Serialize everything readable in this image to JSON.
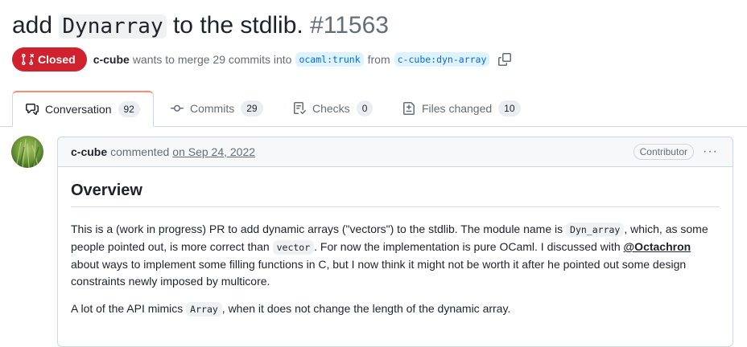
{
  "pr": {
    "title_before": "add ",
    "title_code": "Dynarray",
    "title_after": " to the stdlib. ",
    "number": "#11563",
    "state": "Closed",
    "author": "c-cube",
    "merge_text": "wants to merge 29 commits into",
    "base_branch": "ocaml:trunk",
    "from_text": "from",
    "head_branch": "c-cube:dyn-array"
  },
  "tabs": [
    {
      "label": "Conversation",
      "count": "92",
      "icon": "comment-discussion-icon"
    },
    {
      "label": "Commits",
      "count": "29",
      "icon": "git-commit-icon"
    },
    {
      "label": "Checks",
      "count": "0",
      "icon": "checklist-icon"
    },
    {
      "label": "Files changed",
      "count": "10",
      "icon": "file-diff-icon"
    }
  ],
  "comment": {
    "author": "c-cube",
    "action": "commented",
    "date": "on Sep 24, 2022",
    "badge": "Contributor",
    "menu": "···",
    "heading": "Overview",
    "p1": {
      "t1": "This is a (work in progress) PR to add dynamic arrays (\"vectors\") to the stdlib. The module name is ",
      "c1": "Dyn_array",
      "t2": ", which, as some people pointed out, is more correct than ",
      "c2": "vector",
      "t3": ". For now the implementation is pure OCaml. I discussed with ",
      "mention": "@Octachron",
      "t4": " about ways to implement some filling functions in C, but I now think it might not be worth it after he pointed out some design constraints newly imposed by multicore."
    },
    "p2": {
      "t1": "A lot of the API mimics ",
      "c1": "Array",
      "t2": ", when it does not change the length of the dynamic array."
    }
  },
  "colors": {
    "closed": "#cf222e",
    "branch_text": "#0969da",
    "branch_bg": "#ddf4ff",
    "tab_active_border": "#fd8c73"
  }
}
